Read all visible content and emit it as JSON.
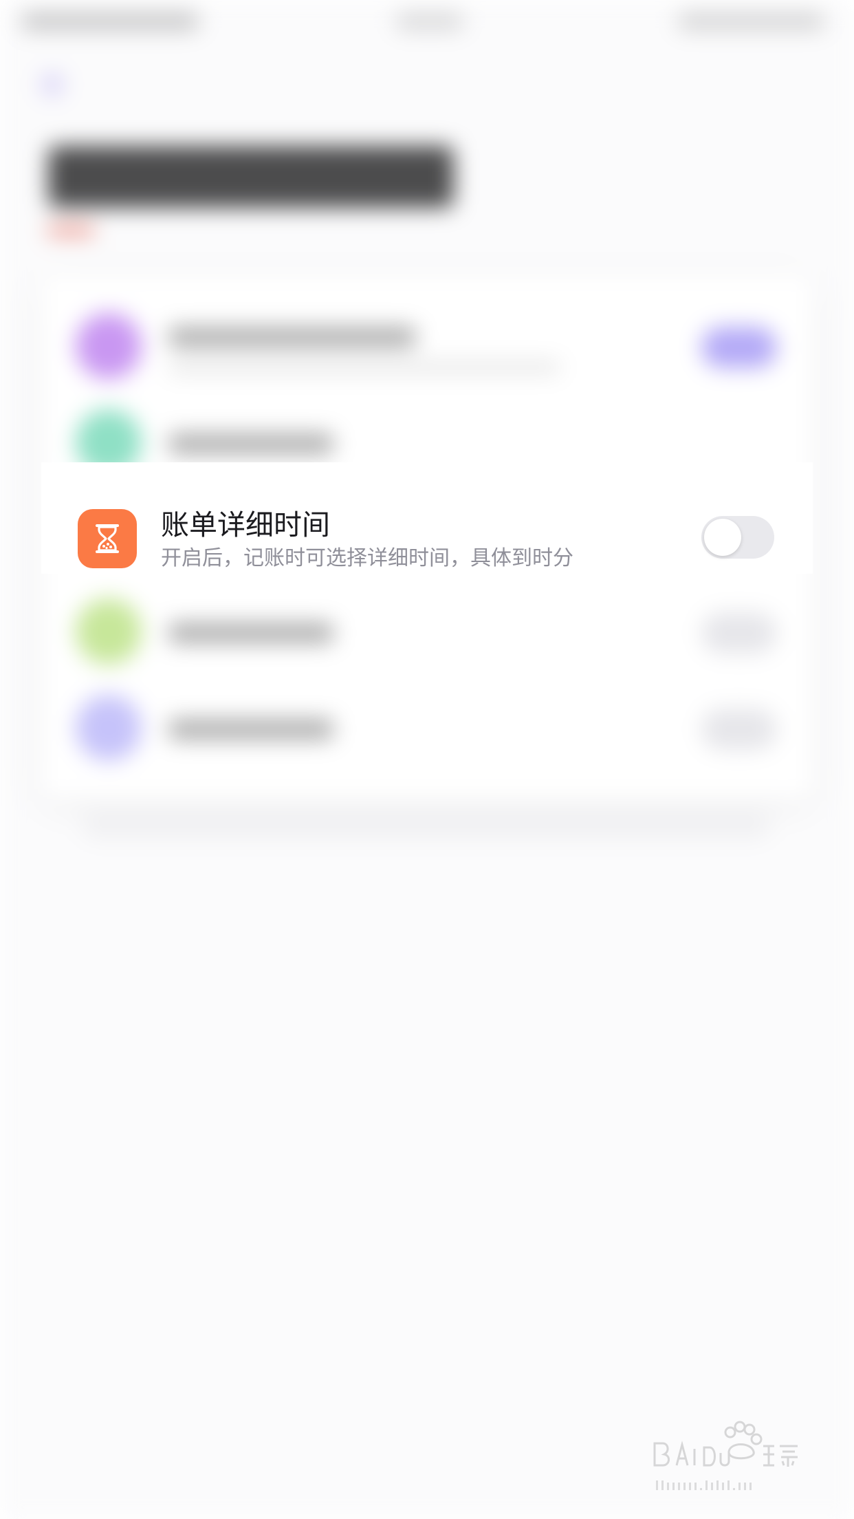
{
  "setting_row": {
    "title": "账单详细时间",
    "description": "开启后，记账时可选择详细时间，具体到时分",
    "icon": "hourglass-icon",
    "icon_color": "#fb7a45",
    "toggle_on": false
  },
  "colors": {
    "background": "#fbfbfc",
    "toggle_off": "#e9e9ed"
  }
}
